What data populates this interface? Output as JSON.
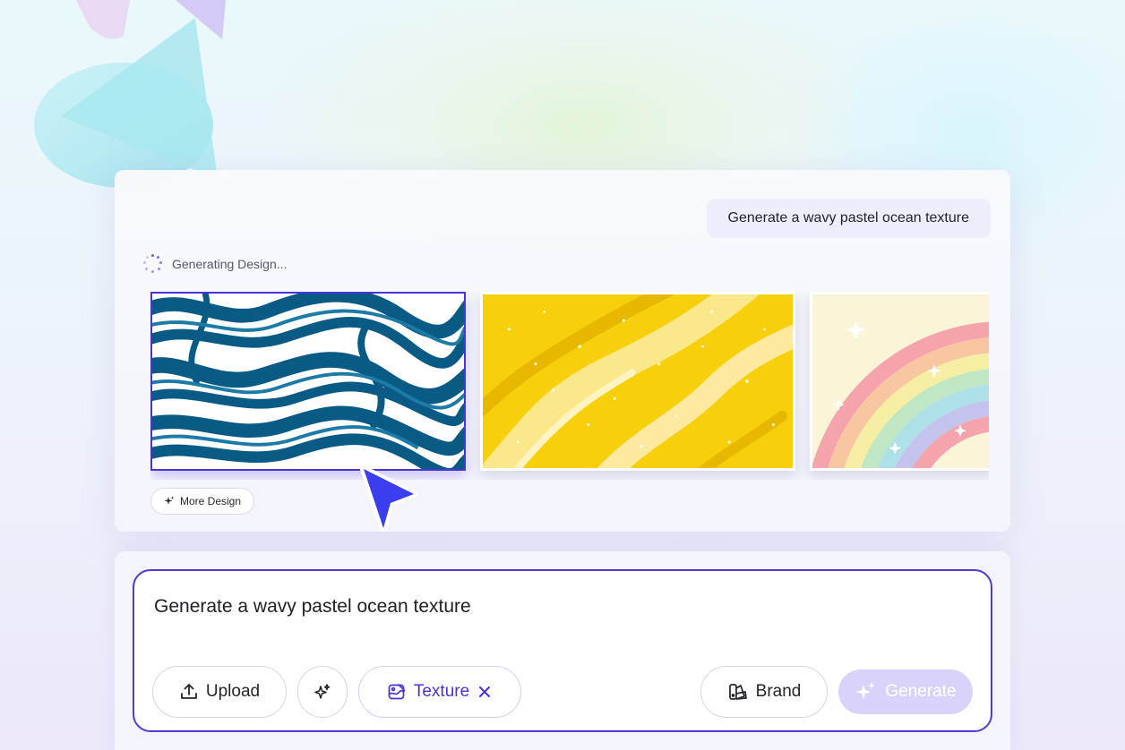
{
  "chat": {
    "user_prompt": "Generate a wavy pastel ocean texture",
    "status_text": "Generating Design...",
    "more_label": "More Design"
  },
  "gallery": {
    "thumbnails": [
      {
        "name": "blue-marble-waves",
        "selected": true
      },
      {
        "name": "yellow-sand-waves",
        "selected": false
      },
      {
        "name": "pastel-rainbow-waves",
        "selected": false
      }
    ]
  },
  "composer": {
    "input_value": "Generate a wavy pastel ocean texture",
    "upload_label": "Upload",
    "texture_label": "Texture",
    "brand_label": "Brand",
    "generate_label": "Generate",
    "icons": [
      "upload-icon",
      "sparkle-icon",
      "texture-icon",
      "close-icon",
      "brand-icon",
      "generate-sparkle-icon"
    ]
  },
  "colors": {
    "accent": "#4e3bd6",
    "generate_button_disabled": "#d9d2fb",
    "cursor": "#3b3ef0"
  }
}
